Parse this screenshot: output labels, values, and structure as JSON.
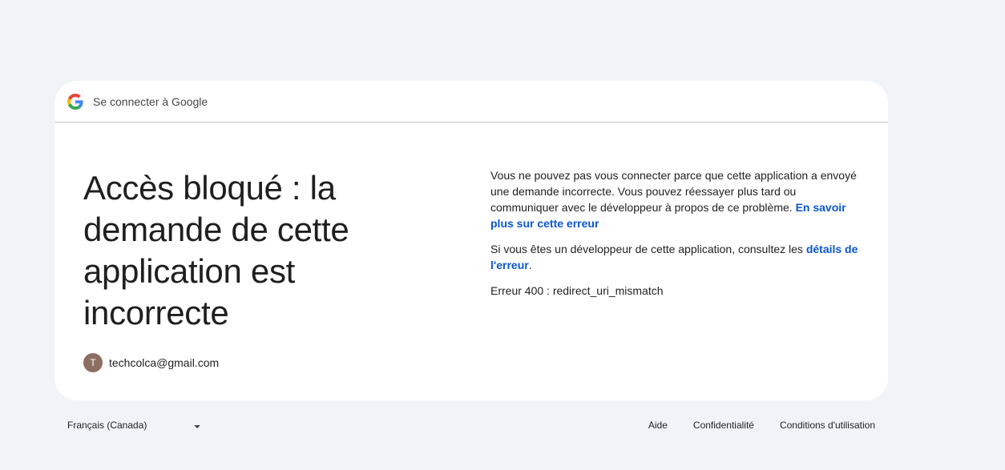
{
  "header": {
    "title": "Se connecter à Google"
  },
  "main": {
    "headline": "Accès bloqué : la demande de cette application est incorrecte",
    "account_initial": "T",
    "account_email": "techcolca@gmail.com",
    "paragraph1_text": "Vous ne pouvez pas vous connecter parce que cette application a envoyé une demande incorrecte. Vous pouvez réessayer plus tard ou communiquer avec le développeur à propos de ce problème. ",
    "paragraph1_link": "En savoir plus sur cette erreur",
    "paragraph2_text": "Si vous êtes un développeur de cette application, consultez les ",
    "paragraph2_link": "détails de l'erreur",
    "paragraph2_end": ".",
    "error_code": "Erreur 400 : redirect_uri_mismatch"
  },
  "footer": {
    "language": "Français (Canada)",
    "links": [
      "Aide",
      "Confidentialité",
      "Conditions d'utilisation"
    ]
  },
  "colors": {
    "link": "#0b57d0",
    "background": "#f0f4f9",
    "card": "#ffffff",
    "avatar": "#8d6e63"
  },
  "icons": {
    "header_logo": "google-logo-icon",
    "language_dropdown": "caret-down-icon"
  }
}
